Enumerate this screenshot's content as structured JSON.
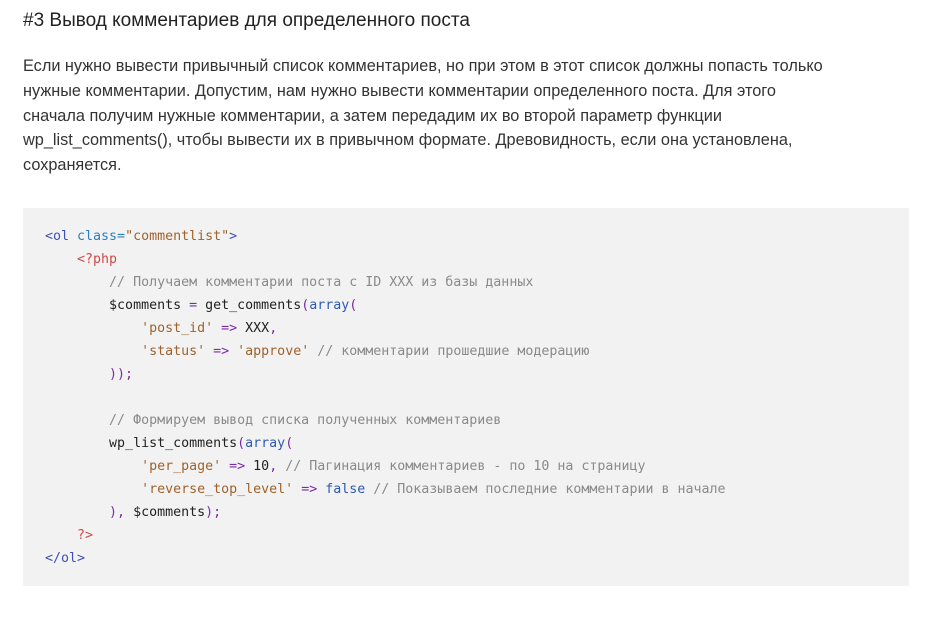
{
  "article": {
    "heading": "#3 Вывод комментариев для определенного поста",
    "paragraph_lines": [
      "Если нужно вывести привычный список комментариев, но при этом в этот список должны попасть только",
      "нужные комментарии. Допустим, нам нужно вывести комментарии определенного поста. Для этого",
      "сначала получим нужные комментарии, а затем передадим их во второй параметр функции",
      "wp_list_comments(), чтобы вывести их в привычном формате. Древовидность, если она установлена,",
      "сохраняется."
    ]
  },
  "code": {
    "lines": [
      [
        {
          "t": "tag",
          "v": "<ol "
        },
        {
          "t": "attr",
          "v": "class="
        },
        {
          "t": "str",
          "v": "\"commentlist\""
        },
        {
          "t": "tag",
          "v": ">"
        }
      ],
      [
        {
          "t": "plain",
          "v": "    "
        },
        {
          "t": "php",
          "v": "<?php"
        }
      ],
      [
        {
          "t": "plain",
          "v": "        "
        },
        {
          "t": "comment",
          "v": "// Получаем комментарии поста с ID XXX из базы данных"
        }
      ],
      [
        {
          "t": "plain",
          "v": "        "
        },
        {
          "t": "var",
          "v": "$comments"
        },
        {
          "t": "op",
          "v": " = "
        },
        {
          "t": "func",
          "v": "get_comments"
        },
        {
          "t": "op",
          "v": "("
        },
        {
          "t": "kw",
          "v": "array"
        },
        {
          "t": "op",
          "v": "("
        }
      ],
      [
        {
          "t": "plain",
          "v": "            "
        },
        {
          "t": "str",
          "v": "'post_id'"
        },
        {
          "t": "op",
          "v": " => "
        },
        {
          "t": "plain",
          "v": "XXX"
        },
        {
          "t": "op",
          "v": ","
        }
      ],
      [
        {
          "t": "plain",
          "v": "            "
        },
        {
          "t": "str",
          "v": "'status'"
        },
        {
          "t": "op",
          "v": " => "
        },
        {
          "t": "str",
          "v": "'approve'"
        },
        {
          "t": "plain",
          "v": " "
        },
        {
          "t": "comment",
          "v": "// комментарии прошедшие модерацию"
        }
      ],
      [
        {
          "t": "plain",
          "v": "        "
        },
        {
          "t": "op",
          "v": "));"
        }
      ],
      [
        {
          "t": "plain",
          "v": ""
        }
      ],
      [
        {
          "t": "plain",
          "v": "        "
        },
        {
          "t": "comment",
          "v": "// Формируем вывод списка полученных комментариев"
        }
      ],
      [
        {
          "t": "plain",
          "v": "        "
        },
        {
          "t": "func",
          "v": "wp_list_comments"
        },
        {
          "t": "op",
          "v": "("
        },
        {
          "t": "kw",
          "v": "array"
        },
        {
          "t": "op",
          "v": "("
        }
      ],
      [
        {
          "t": "plain",
          "v": "            "
        },
        {
          "t": "str",
          "v": "'per_page'"
        },
        {
          "t": "op",
          "v": " => "
        },
        {
          "t": "num",
          "v": "10"
        },
        {
          "t": "op",
          "v": ","
        },
        {
          "t": "plain",
          "v": " "
        },
        {
          "t": "comment",
          "v": "// Пагинация комментариев - по 10 на страницу"
        }
      ],
      [
        {
          "t": "plain",
          "v": "            "
        },
        {
          "t": "str",
          "v": "'reverse_top_level'"
        },
        {
          "t": "op",
          "v": " => "
        },
        {
          "t": "kw",
          "v": "false"
        },
        {
          "t": "plain",
          "v": " "
        },
        {
          "t": "comment",
          "v": "// Показываем последние комментарии в начале"
        }
      ],
      [
        {
          "t": "plain",
          "v": "        "
        },
        {
          "t": "op",
          "v": "), "
        },
        {
          "t": "var",
          "v": "$comments"
        },
        {
          "t": "op",
          "v": ");"
        }
      ],
      [
        {
          "t": "plain",
          "v": "    "
        },
        {
          "t": "php",
          "v": "?>"
        }
      ],
      [
        {
          "t": "tag",
          "v": "</ol>"
        }
      ]
    ]
  }
}
